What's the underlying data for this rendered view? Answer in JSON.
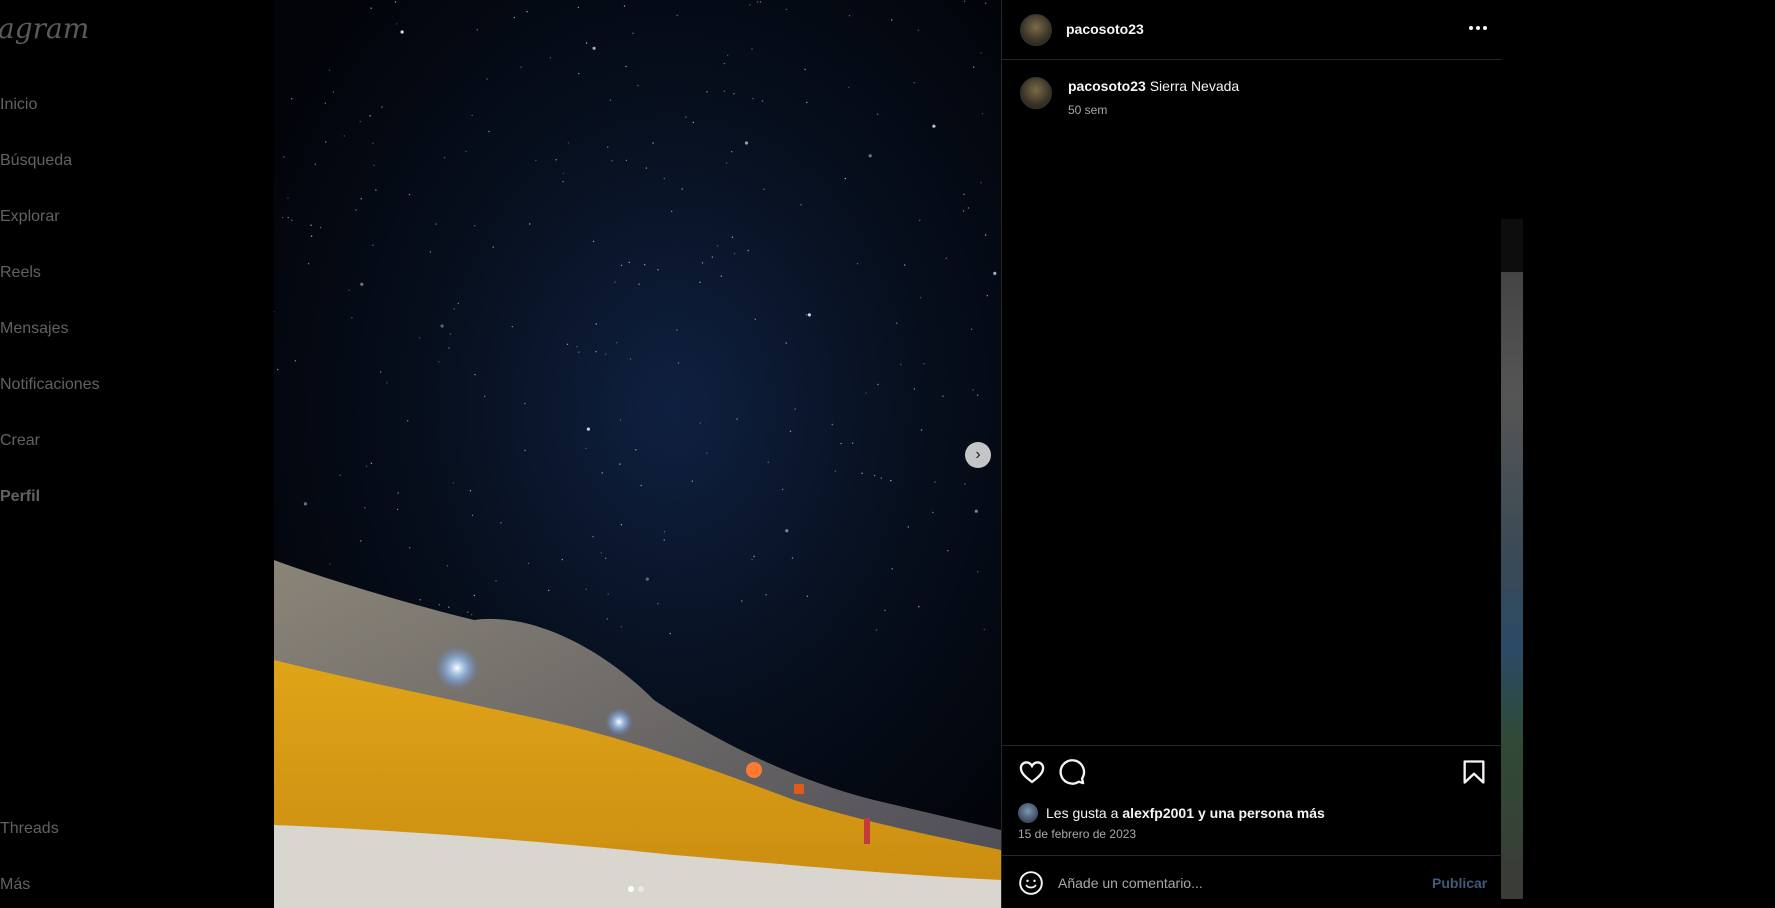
{
  "sidebar": {
    "logo": "agram",
    "items": [
      {
        "label": "Inicio"
      },
      {
        "label": "Búsqueda"
      },
      {
        "label": "Explorar"
      },
      {
        "label": "Reels"
      },
      {
        "label": "Mensajes"
      },
      {
        "label": "Notificaciones"
      },
      {
        "label": "Crear"
      },
      {
        "label": "Perfil"
      }
    ],
    "bottom_items": [
      {
        "label": "Threads"
      },
      {
        "label": "Más"
      }
    ]
  },
  "post": {
    "username": "pacosoto23",
    "caption_user": "pacosoto23",
    "caption_text": "Sierra Nevada",
    "caption_time": "50 sem",
    "likes_prefix": "Les gusta a",
    "likes_user": "alexfp2001",
    "likes_suffix": "y una persona más",
    "date": "15 de febrero de 2023",
    "carousel": {
      "current": 1,
      "total": 2
    }
  },
  "comment": {
    "placeholder": "Añade un comentario...",
    "publish_label": "Publicar"
  },
  "icons": {
    "more": "more-horizontal-icon",
    "like": "heart-icon",
    "comment": "comment-bubble-icon",
    "save": "bookmark-icon",
    "emoji": "emoji-smile-icon",
    "next": "chevron-right-icon"
  },
  "colors": {
    "background": "#000000",
    "border": "#262626",
    "muted_text": "#a8a8a8",
    "publish_disabled": "#3f5a7a"
  }
}
